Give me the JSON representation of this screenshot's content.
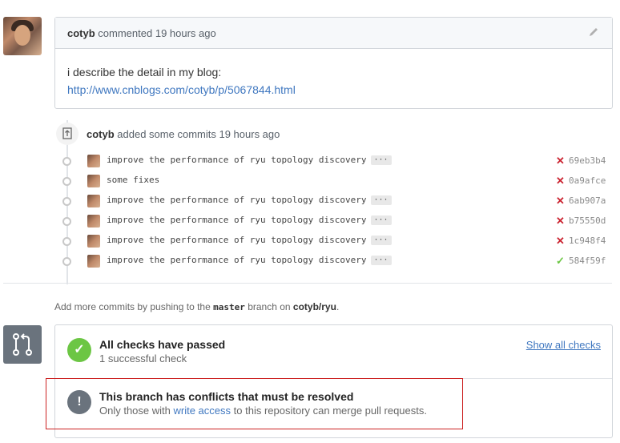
{
  "comment": {
    "author": "cotyb",
    "action": "commented",
    "time": "19 hours ago",
    "body_text": "i describe the detail in my blog:",
    "link": "http://www.cnblogs.com/cotyb/p/5067844.html"
  },
  "push_event": {
    "author": "cotyb",
    "action": "added some commits",
    "time": "19 hours ago"
  },
  "commits": [
    {
      "message": "improve the performance of ryu topology discovery",
      "has_more": true,
      "status": "fail",
      "sha": "69eb3b4"
    },
    {
      "message": "some fixes",
      "has_more": false,
      "status": "fail",
      "sha": "0a9afce"
    },
    {
      "message": "improve the performance of ryu topology discovery",
      "has_more": true,
      "status": "fail",
      "sha": "6ab907a"
    },
    {
      "message": "improve the performance of ryu topology discovery",
      "has_more": true,
      "status": "fail",
      "sha": "b75550d"
    },
    {
      "message": "improve the performance of ryu topology discovery",
      "has_more": true,
      "status": "fail",
      "sha": "1c948f4"
    },
    {
      "message": "improve the performance of ryu topology discovery",
      "has_more": true,
      "status": "pass",
      "sha": "584f59f"
    }
  ],
  "hint": {
    "prefix": "Add more commits by pushing to the",
    "branch": "master",
    "middle": "branch on",
    "repo": "cotyb/ryu",
    "suffix": "."
  },
  "checks": {
    "title": "All checks have passed",
    "subtitle": "1 successful check",
    "show_all": "Show all checks"
  },
  "conflict": {
    "title": "This branch has conflicts that must be resolved",
    "sub_prefix": "Only those with",
    "sub_link": "write access",
    "sub_suffix": "to this repository can merge pull requests."
  },
  "colors": {
    "fail": "#cb2431",
    "pass": "#6cc644",
    "link": "#4078c0"
  },
  "glyphs": {
    "fail": "✕",
    "pass": "✓",
    "more": "···",
    "check": "✓",
    "warn": "!"
  }
}
